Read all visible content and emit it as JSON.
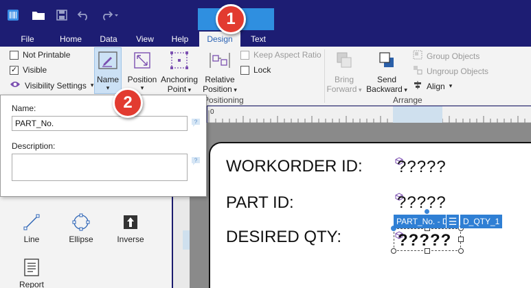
{
  "tabs": [
    "File",
    "Home",
    "Data",
    "View",
    "Help",
    "Design",
    "Text"
  ],
  "ribbon": {
    "visibility": {
      "not_printable": "Not Printable",
      "visible": "Visible",
      "visibility_settings": "Visibility Settings"
    },
    "name_button": "Name",
    "position_button": "Position",
    "anchoring_button_line1": "Anchoring",
    "anchoring_button_line2": "Point",
    "relative_button_line1": "Relative",
    "relative_button_line2": "Position",
    "keep_aspect_ratio": "Keep Aspect Ratio",
    "lock": "Lock",
    "positioning_group": "Positioning",
    "bring_forward_line1": "Bring",
    "bring_forward_line2": "Forward",
    "send_backward_line1": "Send",
    "send_backward_line2": "Backward",
    "align": "Align",
    "group_objects": "Group Objects",
    "ungroup_objects": "Ungroup Objects",
    "arrange_group": "Arrange"
  },
  "popup": {
    "name_label": "Name:",
    "name_value": "PART_No.",
    "description_label": "Description:",
    "description_value": ""
  },
  "toolbox": {
    "line": "Line",
    "ellipse": "Ellipse",
    "inverse": "Inverse",
    "report": "Report"
  },
  "ruler": {
    "origin": "0"
  },
  "label": {
    "workorder_label": "WORKORDER ID:",
    "workorder_value": "?????",
    "part_label": "PART ID:",
    "part_value": "?????",
    "qty_label": "DESIRED QTY:",
    "qty_value": "?????"
  },
  "selection": {
    "tag_left": "PART_No. - D",
    "tag_right": "D_QTY_1"
  },
  "callouts": {
    "one": "1",
    "two": "2"
  },
  "colors": {
    "titlebar": "#1d1d73",
    "accent": "#2f8fe0",
    "callout": "#e23b30"
  }
}
